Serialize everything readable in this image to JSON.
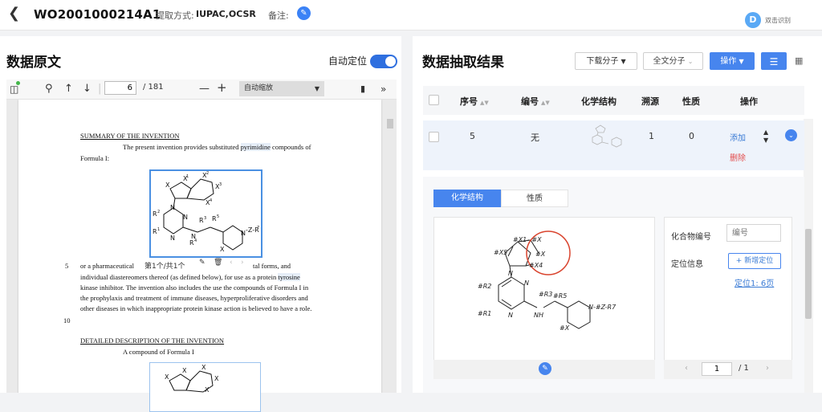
{
  "header": {
    "document_id": "WO2001000214A1",
    "extract_method_label": "提取方式:",
    "extract_method_value": "IUPAC,OCSR",
    "note_label": "备注:",
    "app_name": "双击识别"
  },
  "left": {
    "title": "数据原文",
    "auto_locate_label": "自动定位",
    "auto_locate_on": true,
    "toolbar": {
      "page_current": "6",
      "page_total": "/ 181",
      "zoom": "自动缩放"
    },
    "page": {
      "heading1": "SUMMARY OF THE INVENTION",
      "p1_line1_a": "The present invention provides substituted",
      "p1_line1_hl": "pyrimidine",
      "p1_line1_b": "compounds of",
      "p1_line2": "Formula I:",
      "line_num_5": "5",
      "l5_a": "or a pharmaceutical",
      "l5_b": "tal forms, and",
      "l6_a": "individual diastereomers thereof (as defined below), for use as a protein",
      "l6_hl": "tyrosine",
      "l7": "kinase inhibitor.  The invention also includes the use the compounds of Formula I in",
      "l8": "the prophylaxis and treatment of immune diseases, hyperproliferative disorders and",
      "l9": "other diseases in which inappropriate protein kinase action is believed to have a role.",
      "line_num_10": "10",
      "heading2": "DETAILED DESCRIPTION OF THE INVENTION",
      "l11": "A compound of Formula I",
      "hit_counter": "第1个/共1个"
    }
  },
  "right": {
    "title": "数据抽取结果",
    "buttons": {
      "download": "下载分子",
      "fulltext": "全文分子",
      "action": "操作"
    },
    "columns": [
      "序号",
      "编号",
      "化学结构",
      "溯源",
      "性质",
      "操作"
    ],
    "row": {
      "index": "5",
      "number": "无",
      "source": "1",
      "property": "0",
      "add": "添加",
      "delete": "删除"
    },
    "tabs": [
      "化学结构",
      "性质"
    ],
    "info": {
      "compound_label": "化合物编号",
      "compound_placeholder": "编号",
      "locate_label": "定位信息",
      "add_locate": "+ 新增定位",
      "locate_link": "定位1: 6页",
      "pager_current": "1",
      "pager_total": "/ 1"
    }
  },
  "colors": {
    "accent": "#4785ee",
    "delete": "#e34d4d",
    "highlight_circle": "#d9442e"
  }
}
